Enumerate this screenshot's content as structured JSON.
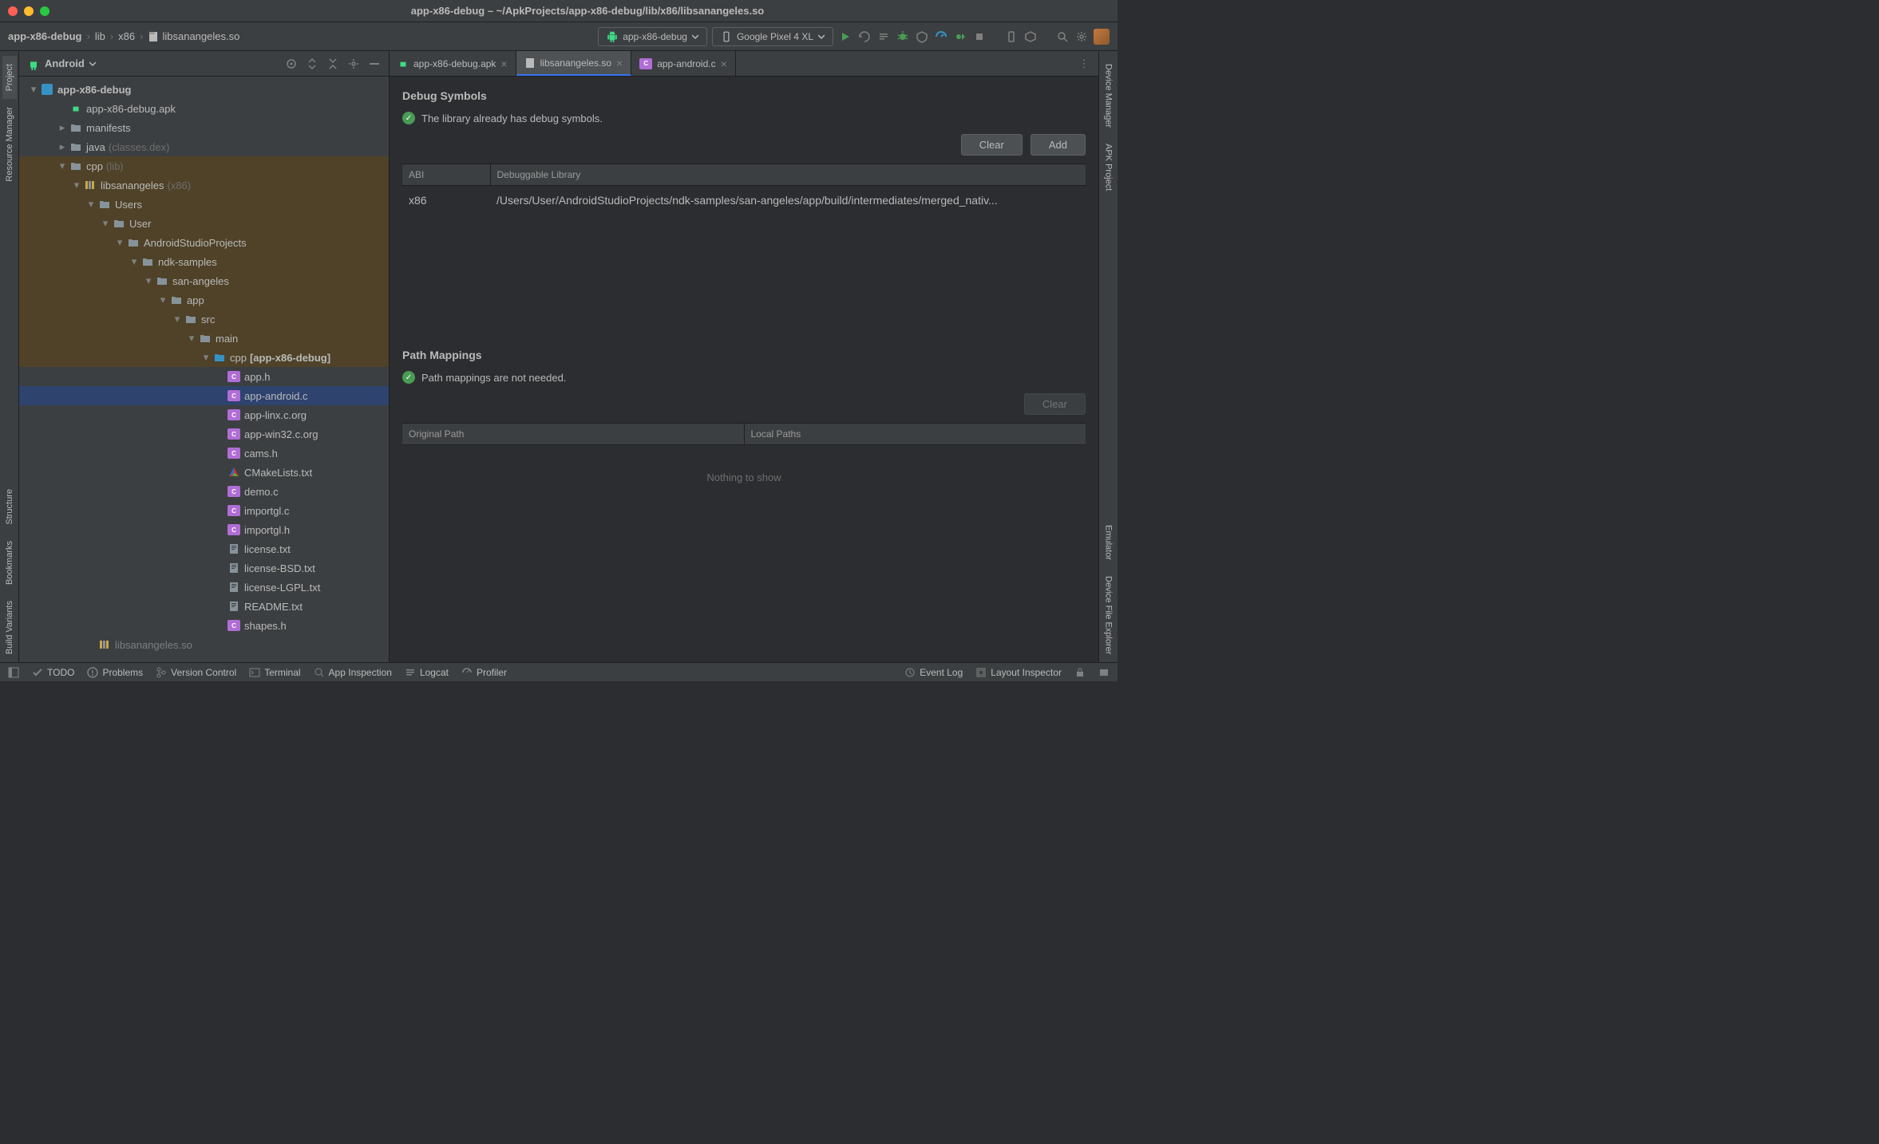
{
  "window": {
    "title": "app-x86-debug – ~/ApkProjects/app-x86-debug/lib/x86/libsanangeles.so"
  },
  "breadcrumb": {
    "items": [
      "app-x86-debug",
      "lib",
      "x86",
      "libsanangeles.so"
    ]
  },
  "toolbar": {
    "config": "app-x86-debug",
    "device": "Google Pixel 4 XL"
  },
  "leftGutter": {
    "tabs": [
      "Project",
      "Resource Manager",
      "Structure",
      "Bookmarks",
      "Build Variants"
    ]
  },
  "rightGutter": {
    "tabs": [
      "Device Manager",
      "APK Project",
      "Emulator",
      "Device File Explorer"
    ]
  },
  "projectPanel": {
    "mode": "Android"
  },
  "tree": {
    "root": "app-x86-debug",
    "items": [
      {
        "label": "app-x86-debug.apk",
        "indent": 2,
        "icon": "apk"
      },
      {
        "label": "manifests",
        "indent": 2,
        "icon": "folder",
        "arrow": "right"
      },
      {
        "label": "java",
        "suffix": "(classes.dex)",
        "indent": 2,
        "icon": "folder",
        "arrow": "right"
      },
      {
        "label": "cpp",
        "suffix": "(lib)",
        "indent": 2,
        "icon": "folder",
        "arrow": "down",
        "highlighted": true
      },
      {
        "label": "libsanangeles",
        "suffix": "(x86)",
        "indent": 3,
        "icon": "lib",
        "arrow": "down",
        "highlighted": true
      },
      {
        "label": "Users",
        "indent": 4,
        "icon": "folder",
        "arrow": "down",
        "highlighted": true
      },
      {
        "label": "User",
        "indent": 5,
        "icon": "folder",
        "arrow": "down",
        "highlighted": true
      },
      {
        "label": "AndroidStudioProjects",
        "indent": 6,
        "icon": "folder",
        "arrow": "down",
        "highlighted": true
      },
      {
        "label": "ndk-samples",
        "indent": 7,
        "icon": "folder",
        "arrow": "down",
        "highlighted": true
      },
      {
        "label": "san-angeles",
        "indent": 8,
        "icon": "folder",
        "arrow": "down",
        "highlighted": true
      },
      {
        "label": "app",
        "indent": 9,
        "icon": "folder",
        "arrow": "down",
        "highlighted": true
      },
      {
        "label": "src",
        "indent": 10,
        "icon": "folder",
        "arrow": "down",
        "highlighted": true
      },
      {
        "label": "main",
        "indent": 11,
        "icon": "folder",
        "arrow": "down",
        "highlighted": true
      },
      {
        "label": "cpp",
        "suffix_bold": "[app-x86-debug]",
        "indent": 12,
        "icon": "folder-source",
        "arrow": "down",
        "highlighted": true
      },
      {
        "label": "app.h",
        "indent": 13,
        "icon": "c-file"
      },
      {
        "label": "app-android.c",
        "indent": 13,
        "icon": "c-file",
        "selected": true
      },
      {
        "label": "app-linx.c.org",
        "indent": 13,
        "icon": "c-file"
      },
      {
        "label": "app-win32.c.org",
        "indent": 13,
        "icon": "c-file"
      },
      {
        "label": "cams.h",
        "indent": 13,
        "icon": "c-file"
      },
      {
        "label": "CMakeLists.txt",
        "indent": 13,
        "icon": "cmake"
      },
      {
        "label": "demo.c",
        "indent": 13,
        "icon": "c-file"
      },
      {
        "label": "importgl.c",
        "indent": 13,
        "icon": "c-file"
      },
      {
        "label": "importgl.h",
        "indent": 13,
        "icon": "c-file"
      },
      {
        "label": "license.txt",
        "indent": 13,
        "icon": "text"
      },
      {
        "label": "license-BSD.txt",
        "indent": 13,
        "icon": "text"
      },
      {
        "label": "license-LGPL.txt",
        "indent": 13,
        "icon": "text"
      },
      {
        "label": "README.txt",
        "indent": 13,
        "icon": "text"
      },
      {
        "label": "shapes.h",
        "indent": 13,
        "icon": "c-file"
      },
      {
        "label": "libsanangeles.so",
        "indent": 4,
        "icon": "lib",
        "dim": true
      }
    ]
  },
  "editorTabs": {
    "tabs": [
      {
        "label": "app-x86-debug.apk",
        "icon": "apk"
      },
      {
        "label": "libsanangeles.so",
        "icon": "file",
        "active": true
      },
      {
        "label": "app-android.c",
        "icon": "c-file"
      }
    ]
  },
  "debugSymbols": {
    "title": "Debug Symbols",
    "status": "The library already has debug symbols.",
    "buttons": {
      "clear": "Clear",
      "add": "Add"
    },
    "table": {
      "headers": [
        "ABI",
        "Debuggable Library"
      ],
      "rows": [
        {
          "abi": "x86",
          "path": "/Users/User/AndroidStudioProjects/ndk-samples/san-angeles/app/build/intermediates/merged_nativ..."
        }
      ]
    }
  },
  "pathMappings": {
    "title": "Path Mappings",
    "status": "Path mappings are not needed.",
    "buttons": {
      "clear": "Clear"
    },
    "table": {
      "headers": [
        "Original Path",
        "Local Paths"
      ],
      "empty": "Nothing to show"
    }
  },
  "statusBar": {
    "left": [
      "TODO",
      "Problems",
      "Version Control",
      "Terminal",
      "App Inspection",
      "Logcat",
      "Profiler"
    ],
    "right": [
      "Event Log",
      "Layout Inspector"
    ]
  }
}
